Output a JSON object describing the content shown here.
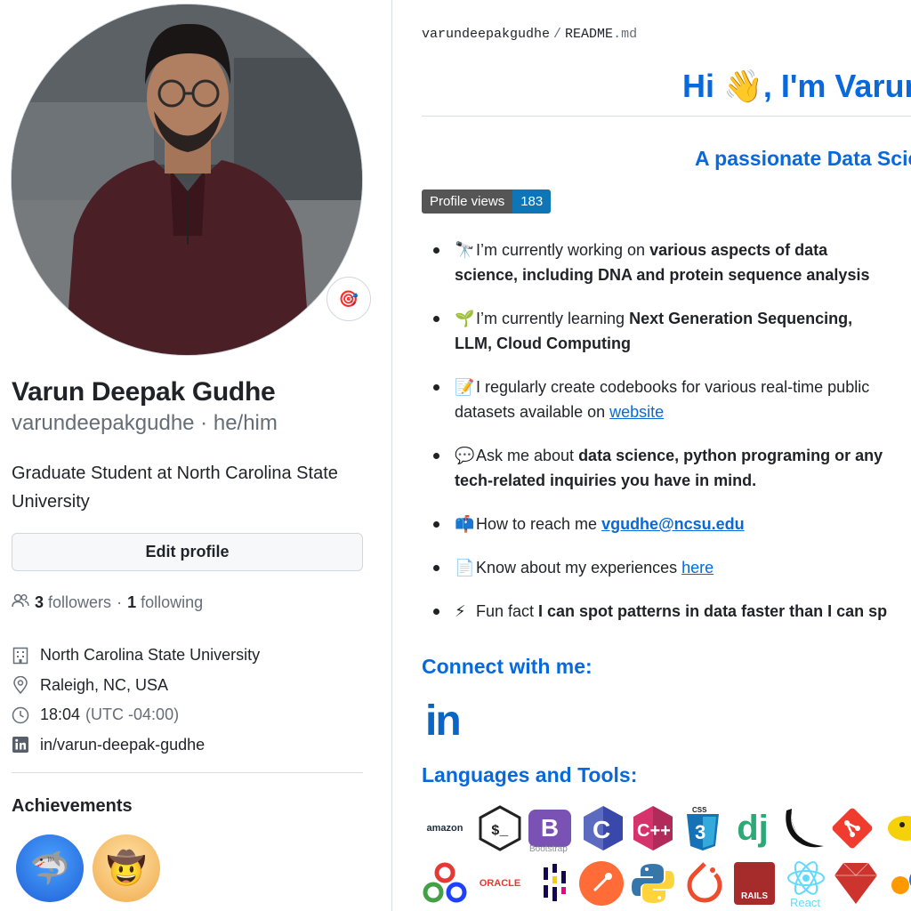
{
  "profile": {
    "full_name": "Varun Deepak Gudhe",
    "username_line": "varundeepakgudhe · he/him",
    "bio": "Graduate Student at North Carolina State University",
    "edit_button": "Edit profile",
    "followers_count": "3",
    "followers_label": "followers",
    "following_count": "1",
    "following_label": "following",
    "status_emoji": "🎯",
    "details": {
      "org": "North Carolina State University",
      "location": "Raleigh, NC, USA",
      "time": "18:04",
      "timezone": "(UTC -04:00)",
      "linkedin": "in/varun-deepak-gudhe"
    },
    "achievements_title": "Achievements",
    "achievements": [
      {
        "icon": "shark-badge-icon",
        "glyph": "🦈"
      },
      {
        "icon": "cowboy-badge-icon",
        "glyph": "🤠"
      }
    ]
  },
  "readme": {
    "crumb_user": "varundeepakgudhe",
    "crumb_sep": "/",
    "crumb_file": "README",
    "crumb_ext": ".md",
    "heading": "Hi 👋, I'm Varun",
    "subheading": "A passionate Data Scie",
    "views_label": "Profile views",
    "views_count": "183",
    "facts": [
      {
        "emoji": "🔭",
        "pre": "I’m currently working on ",
        "bold": "various aspects of data",
        "line2_bold": "science, including DNA and protein sequence analysis"
      },
      {
        "emoji": "🌱",
        "pre": "I’m currently learning ",
        "bold": "Next Generation Sequencing,",
        "line2_bold": "LLM, Cloud Computing"
      },
      {
        "emoji": "📝",
        "pre": "I regularly create codebooks for various real-time public",
        "line2_pre": "datasets available on ",
        "link": "website"
      },
      {
        "emoji": "💬",
        "pre": "Ask me about ",
        "bold": "data science, python programing or any",
        "line2_bold": "tech-related inquiries you have in mind."
      },
      {
        "emoji": "📫",
        "pre": "How to reach me ",
        "link": "vgudhe@ncsu.edu"
      },
      {
        "emoji": "📄",
        "pre": "Know about my experiences ",
        "link": "here"
      },
      {
        "emoji": "⚡",
        "pre": "Fun fact ",
        "bold": "I can spot patterns in data faster than I can sp"
      }
    ],
    "connect_title": "Connect with me:",
    "linkedin_glyph": "in",
    "languages_title": "Languages and Tools:",
    "tools_row1": [
      "aws",
      "bash",
      "bootstrap",
      "c",
      "cplusplus",
      "css3",
      "django",
      "flask",
      "git",
      "hadoop"
    ],
    "tools_row2": [
      "kubeflow",
      "oracle",
      "pandas",
      "postman",
      "python",
      "pytorch",
      "rails",
      "react",
      "ruby",
      "more"
    ],
    "tool_text": {
      "aws": "amazon",
      "bootstrap_letter": "B",
      "bootstrap_caption": "Bootstrap",
      "c": "C",
      "cpp": "C++",
      "css": "CSS",
      "django": "dj",
      "oracle": "ORACLE",
      "rails": "RAILS",
      "react_caption": "React"
    }
  },
  "colors": {
    "link": "#0969da",
    "text": "#1f2328",
    "muted": "#656d76",
    "border": "#d0d7de",
    "views_right": "#0e75b6"
  }
}
